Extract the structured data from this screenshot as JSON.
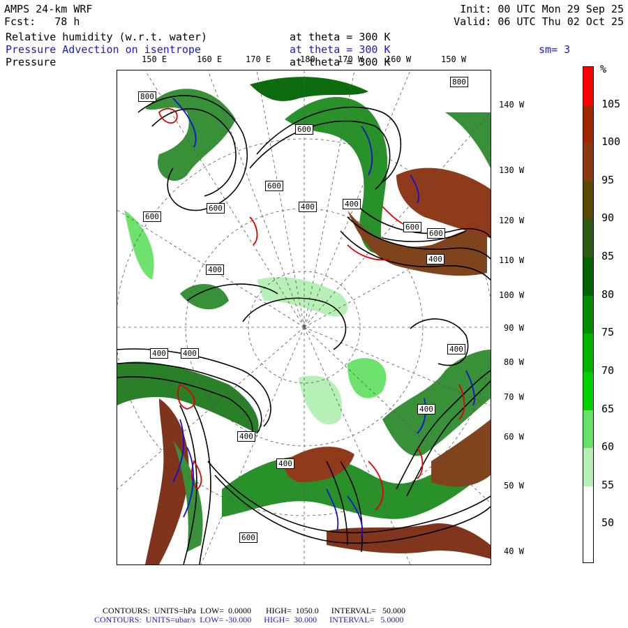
{
  "header": {
    "model": "AMPS 24-km WRF",
    "fcst_label": "Fcst:",
    "fcst_value": "78 h",
    "init": "Init: 00 UTC Mon 29 Sep 25",
    "valid": "Valid: 06 UTC Thu 02 Oct 25",
    "field1": "Relative humidity (w.r.t. water)",
    "field1_level": "at theta = 300 K",
    "field2": "Pressure Advection on isentrope",
    "field2_level": "at theta = 300 K",
    "field2_smooth": "sm= 3",
    "field3": "Pressure",
    "field3_level": "at theta = 300 K"
  },
  "top_longitudes": [
    "150 E",
    "160 E",
    "170 E",
    "180",
    "170 W",
    "160 W",
    "150 W"
  ],
  "right_longitudes": [
    "140 W",
    "130 W",
    "120 W",
    "110 W",
    "100 W",
    "90 W",
    "80 W",
    "70 W",
    "60 W",
    "50 W",
    "40 W"
  ],
  "contour_labels": [
    "800",
    "600",
    "600",
    "600",
    "600",
    "400",
    "400",
    "600",
    "600",
    "400",
    "400",
    "400",
    "400",
    "400",
    "400",
    "400",
    "400",
    "600",
    "800"
  ],
  "colorbar": {
    "unit": "%",
    "labels": [
      "105",
      "100",
      "95",
      "90",
      "85",
      "80",
      "75",
      "70",
      "65",
      "60",
      "55",
      "50"
    ],
    "colors": [
      "#ff0000",
      "#a02800",
      "#8b3a0f",
      "#5a4a00",
      "#2e5a14",
      "#006400",
      "#008c00",
      "#00b400",
      "#00d200",
      "#66e266",
      "#b4f0b4",
      "#ffffff",
      "#ffffff"
    ]
  },
  "footer": {
    "line1": "CONTOURS:  UNITS=hPa  LOW=  0.0000       HIGH=  1050.0      INTERVAL=   50.000",
    "line2": "CONTOURS:  UNITS=ubar/s  LOW= -30.000      HIGH=  30.000      INTERVAL=   5.0000"
  }
}
